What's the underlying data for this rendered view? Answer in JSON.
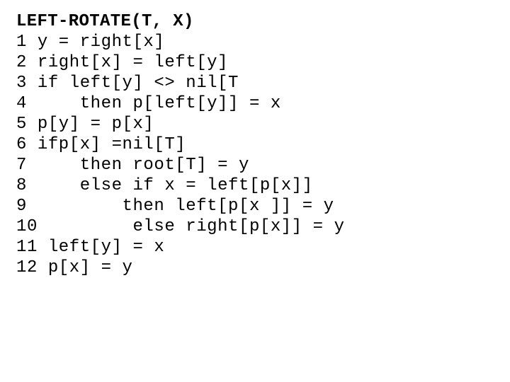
{
  "slide": {
    "background_color": "#ffffff",
    "text_color": "#000000",
    "algorithm": {
      "title": "LEFT-ROTATE(T, X)",
      "lines": [
        "1 y = right[x]",
        "2 right[x] = left[y]",
        "3 if left[y] <> nil[T",
        "4     then p[left[y]] = x",
        "5 p[y] = p[x]",
        "6 ifp[x] =nil[T]",
        "7     then root[T] = y",
        "8     else if x = left[p[x]]",
        "9         then left[p[x ]] = y",
        "10         else right[p[x]] = y",
        "11 left[y] = x",
        "12 p[x] = y"
      ]
    }
  }
}
